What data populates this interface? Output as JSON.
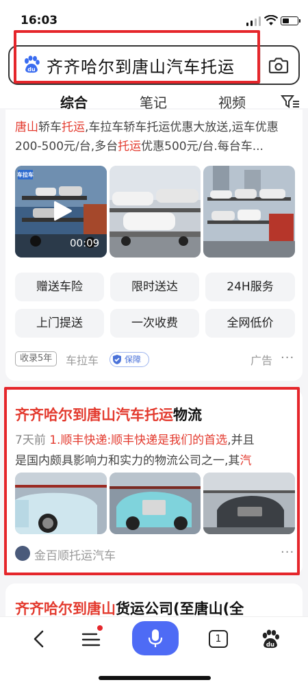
{
  "status_bar": {
    "time": "16:03"
  },
  "search": {
    "query": "齐齐哈尔到唐山汽车托运"
  },
  "tabs": [
    {
      "label": "综合",
      "active": true
    },
    {
      "label": "笔记",
      "active": false
    },
    {
      "label": "视频",
      "active": false
    }
  ],
  "result1": {
    "snippet_parts": [
      "唐山",
      "轿车",
      "托运",
      ",车拉车轿车托运优惠大放送,运车优惠200-500元/台,多台",
      "托运",
      "优惠500元/台.每台车..."
    ],
    "video_duration": "00:09",
    "thumb_watermark": "车拉车",
    "tags": [
      "赠送车险",
      "限时送达",
      "24H服务",
      "上门提送",
      "一次收费",
      "全网低价"
    ],
    "badge": "收录5年",
    "source": "车拉车",
    "guarantee": "保障",
    "ad_label": "广告",
    "more": "···"
  },
  "result2": {
    "title_highlight": "齐齐哈尔到唐山汽车托运",
    "title_rest": "物流",
    "date": "7天前",
    "snippet_highlight": "1.顺丰快递:顺丰快递是我们的首选",
    "snippet_line1_rest": ",并且",
    "snippet_line2": "是国内颇具影响力和实力的物流公司之一,其",
    "snippet_line2_hl": "汽",
    "source": "金百顺托运汽车",
    "more": "···"
  },
  "result3": {
    "title_hl1": "齐齐哈尔到唐山",
    "title_rest": "货运公司(至唐山(全"
  },
  "bottom_nav": {
    "tabs_count": "1"
  },
  "colors": {
    "highlight": "#e33a2e",
    "accent": "#4e6bf5",
    "annotation_box": "#e5262b"
  }
}
